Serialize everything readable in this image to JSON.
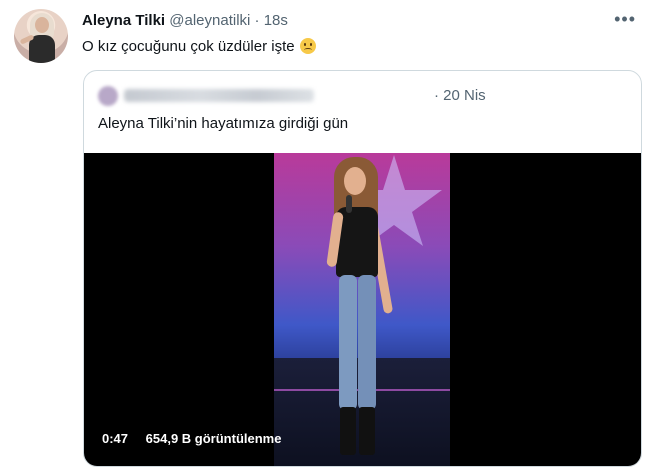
{
  "tweet": {
    "author_name": "Aleyna Tilki",
    "author_handle": "@aleynatilki",
    "separator": "·",
    "time": "18s",
    "text": "O kız çocuğunu çok üzdüler işte",
    "emoji": "smiling-face-with-tear"
  },
  "quoted_tweet": {
    "time": "· 20 Nis",
    "text": "Aleyna Tilki’nin hayatımıza girdiği gün",
    "video": {
      "duration": "0:47",
      "views": "654,9 B görüntülenme"
    }
  },
  "colors": {
    "text_primary": "#0f1419",
    "text_secondary": "#536471",
    "border": "#cfd9de"
  }
}
